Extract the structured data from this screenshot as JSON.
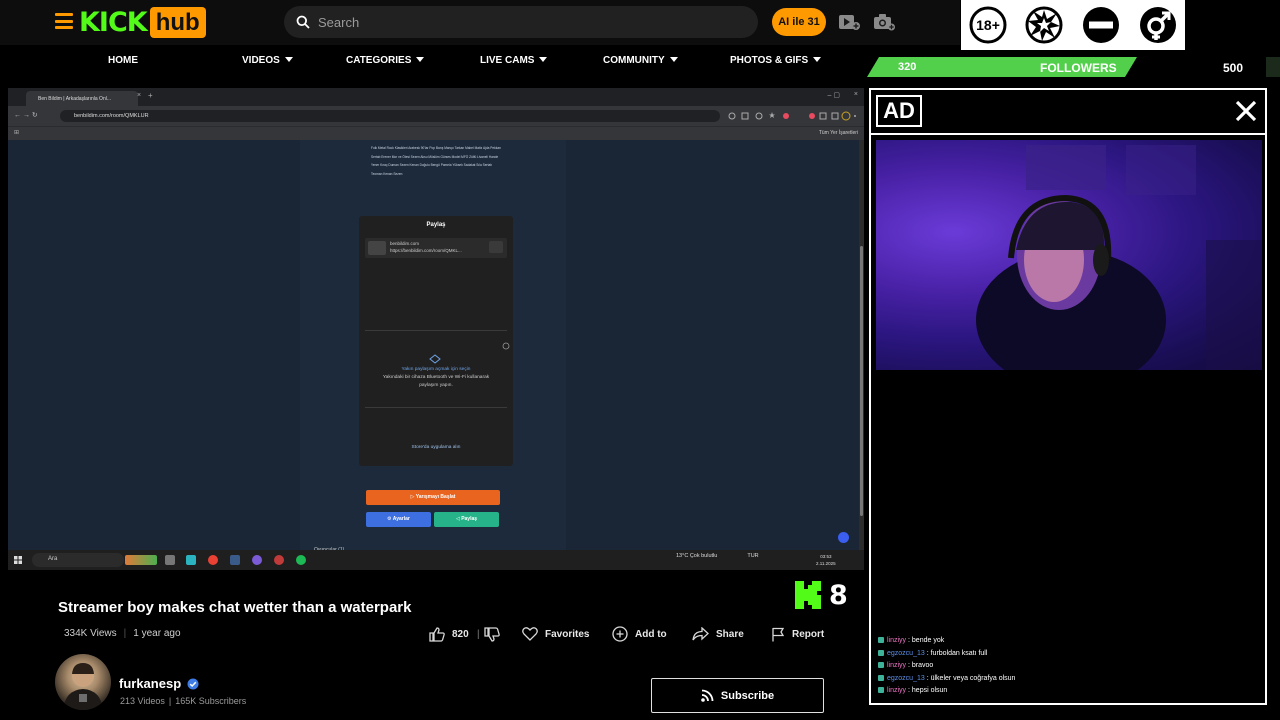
{
  "header": {
    "search_placeholder": "Search",
    "promo_label": "AI ile 31",
    "icons": [
      "menu-icon",
      "search-icon",
      "video-upload-icon",
      "camera-icon"
    ]
  },
  "nav": {
    "items": [
      {
        "label": "HOME",
        "dropdown": false
      },
      {
        "label": "VIDEOS",
        "dropdown": true
      },
      {
        "label": "CATEGORIES",
        "dropdown": true
      },
      {
        "label": "LIVE CAMS",
        "dropdown": true
      },
      {
        "label": "COMMUNITY",
        "dropdown": true
      },
      {
        "label": "PHOTOS & GIFS",
        "dropdown": true
      }
    ]
  },
  "overlay": {
    "badges": [
      "18-plus-icon",
      "blast-icon",
      "no-entry-icon",
      "gender-icon"
    ],
    "followers": {
      "current": "320",
      "label": "FOLLOWERS",
      "goal": "500"
    },
    "ad_label": "AD",
    "chat": [
      {
        "user": "linziyy",
        "user_color": "#f176c8",
        "message": ": bende yok"
      },
      {
        "user": "egzozcu_13",
        "user_color": "#5d8fe8",
        "message": ": furboldan ksatı full"
      },
      {
        "user": "linziyy",
        "user_color": "#f176c8",
        "message": ": bravoo"
      },
      {
        "user": "egzozcu_13",
        "user_color": "#5d8fe8",
        "message": ": ülkeler veya coğrafya olsun"
      },
      {
        "user": "linziyy",
        "user_color": "#f176c8",
        "message": ": hepsi olsun"
      }
    ]
  },
  "screen": {
    "tab_title": "Ben Bildim | Arkadaşlarınla Onl...",
    "url": "benbildim.com/room/QMKLUR",
    "bookmarks_right": "Tüm Yer İşaretleri",
    "tags": "Folk Metal   Rock Klasikleri   Arabesk   90'lar Pop   Barış Manço   Tarkan   Mabel Matiz   Ajda Pekkan   Sertab Erener   Mor ve Ötesi   Sezen Aksu   Müslüm Gürses   Model   MFÖ   Zülfü Livaneli   Hande Yener   Kıraç   Duman   Sezen   Kenan Doğulu   Bengü   Pamela   Yüksek Sadakat   Sıla   Sertab   Teoman   Kenan   Sezen",
    "share_title": "Paylaş",
    "share_site": "benbildim.com",
    "share_url": "https://benbildim.com/room/QMKL...",
    "share_near_1": "Yakın paylaşım açmak için seçin",
    "share_near_2": "Yakındaki bir cihaza Bluetooth ve Wi-Fi kullanarak",
    "share_near_3": "paylaşım yapın.",
    "share_store": "Store'da uygulama alın",
    "btn_start": "▷ Yarışmayı Başlat",
    "btn_settings": "⚙ Ayarlar",
    "btn_share": "◁ Paylaş",
    "bottom_text": "Oyuncular (1)",
    "taskbar_search": "Ara",
    "tray_weather": "13°C  Çok bulutlu",
    "tray_lang": "TUR",
    "clock_time": "03:53",
    "clock_date": "2.11.2025"
  },
  "video_info": {
    "title": "Streamer boy makes chat wetter than a waterpark",
    "views": "334K Views",
    "age": "1 year ago",
    "counter": "8",
    "likes": "820",
    "favorites_label": "Favorites",
    "add_to_label": "Add to",
    "share_label": "Share",
    "report_label": "Report"
  },
  "channel": {
    "name": "furkanesp",
    "videos": "213 Videos",
    "subscribers": "165K Subscribers",
    "subscribe_label": "Subscribe",
    "verified": true
  },
  "colors": {
    "kick_green": "#53fc18",
    "brand_orange": "#ff9900",
    "followers_green": "#53d04b"
  }
}
